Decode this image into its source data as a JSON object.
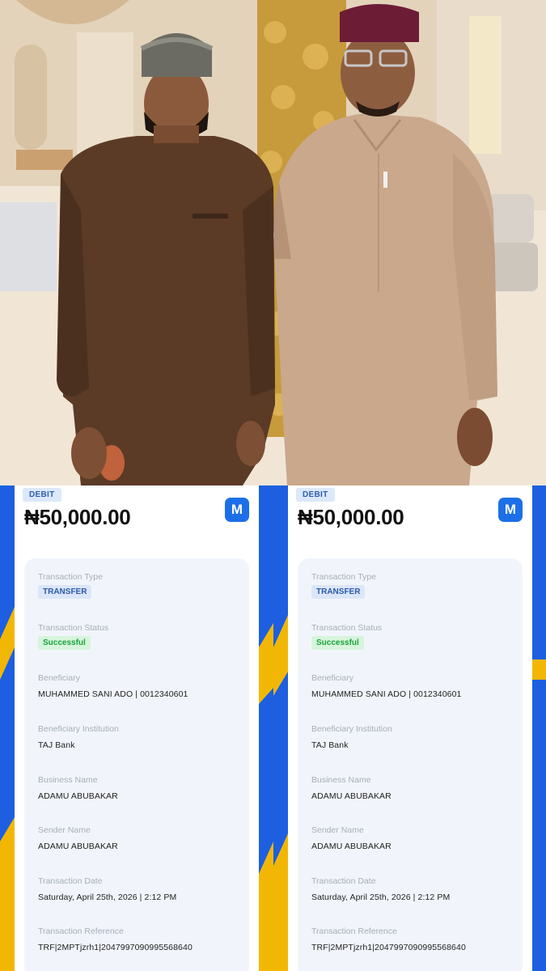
{
  "receipts": [
    {
      "badge": "DEBIT",
      "amount": "₦50,000.00",
      "logo_letter": "M",
      "fields": {
        "type_label": "Transaction Type",
        "type_value": "TRANSFER",
        "status_label": "Transaction Status",
        "status_value": "Successful",
        "beneficiary_label": "Beneficiary",
        "beneficiary_value": "MUHAMMED SANI ADO | 0012340601",
        "institution_label": "Beneficiary Institution",
        "institution_value": "TAJ Bank",
        "business_label": "Business Name",
        "business_value": "ADAMU ABUBAKAR",
        "sender_label": "Sender Name",
        "sender_value": "ADAMU ABUBAKAR",
        "date_label": "Transaction Date",
        "date_value": "Saturday, April 25th, 2026 | 2:12 PM",
        "reference_label": "Transaction Reference",
        "reference_value": "TRF|2MPTjzrh1|2047997090995568640"
      }
    },
    {
      "badge": "DEBIT",
      "amount": "₦50,000.00",
      "logo_letter": "M",
      "fields": {
        "type_label": "Transaction Type",
        "type_value": "TRANSFER",
        "status_label": "Transaction Status",
        "status_value": "Successful",
        "beneficiary_label": "Beneficiary",
        "beneficiary_value": "MUHAMMED SANI ADO | 0012340601",
        "institution_label": "Beneficiary Institution",
        "institution_value": "TAJ Bank",
        "business_label": "Business Name",
        "business_value": "ADAMU ABUBAKAR",
        "sender_label": "Sender Name",
        "sender_value": "ADAMU ABUBAKAR",
        "date_label": "Transaction Date",
        "date_value": "Saturday, April 25th, 2026 | 2:12 PM",
        "reference_label": "Transaction Reference",
        "reference_value": "TRF|2MPTjzrh1|2047997090995568640"
      }
    }
  ],
  "colors": {
    "brand_blue": "#1d5fe0",
    "accent_yellow": "#f2b705",
    "success_green": "#1ca23b"
  }
}
